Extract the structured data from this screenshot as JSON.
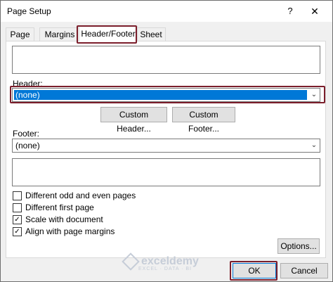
{
  "window": {
    "title": "Page Setup",
    "help_glyph": "?",
    "close_glyph": "✕"
  },
  "tabs": [
    {
      "label": "Page"
    },
    {
      "label": "Margins"
    },
    {
      "label": "Header/Footer",
      "active": true
    },
    {
      "label": "Sheet"
    }
  ],
  "header": {
    "label": "Header:",
    "value": "(none)"
  },
  "buttons": {
    "custom_header": "Custom Header...",
    "custom_footer": "Custom Footer...",
    "options": "Options...",
    "ok": "OK",
    "cancel": "Cancel"
  },
  "footer": {
    "label": "Footer:",
    "value": "(none)"
  },
  "checkboxes": [
    {
      "label": "Different odd and even pages",
      "checked": false
    },
    {
      "label": "Different first page",
      "checked": false
    },
    {
      "label": "Scale with document",
      "checked": true
    },
    {
      "label": "Align with page margins",
      "checked": true
    }
  ],
  "watermark": {
    "brand": "exceldemy",
    "tagline": "EXCEL · DATA · BI"
  },
  "colors": {
    "selection": "#0078d7",
    "highlight_border": "#7b1e2b"
  }
}
